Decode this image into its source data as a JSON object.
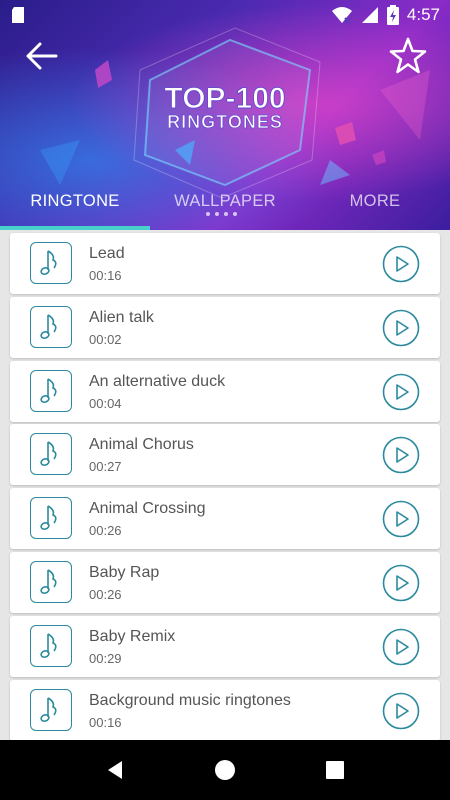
{
  "status_bar": {
    "time": "4:57",
    "icons": [
      "sd-card-icon",
      "wifi-icon",
      "cellular-icon",
      "battery-charging-icon"
    ]
  },
  "banner": {
    "logo_line1": "TOP-100",
    "logo_line2": "RINGTONES"
  },
  "tabs": [
    {
      "label": "RINGTONE",
      "active": true
    },
    {
      "label": "WALLPAPER",
      "active": false
    },
    {
      "label": "MORE",
      "active": false
    }
  ],
  "ringtones": [
    {
      "title": "Lead",
      "duration": "00:16"
    },
    {
      "title": "Alien talk",
      "duration": "00:02"
    },
    {
      "title": "An alternative duck",
      "duration": "00:04"
    },
    {
      "title": "Animal Chorus",
      "duration": "00:27"
    },
    {
      "title": "Animal Crossing",
      "duration": "00:26"
    },
    {
      "title": "Baby Rap",
      "duration": "00:26"
    },
    {
      "title": "Baby Remix",
      "duration": "00:29"
    },
    {
      "title": "Background music ringtones",
      "duration": "00:16"
    }
  ],
  "colors": {
    "accent": "#2b8a9e",
    "tab_indicator": "#48d1cc",
    "banner_dark": "#2a1d8a",
    "banner_pink": "#ff50c8"
  },
  "icons": {
    "back": "arrow-left-icon",
    "favorite": "star-outline-icon",
    "item": "music-note-icon",
    "play": "play-circle-icon"
  }
}
